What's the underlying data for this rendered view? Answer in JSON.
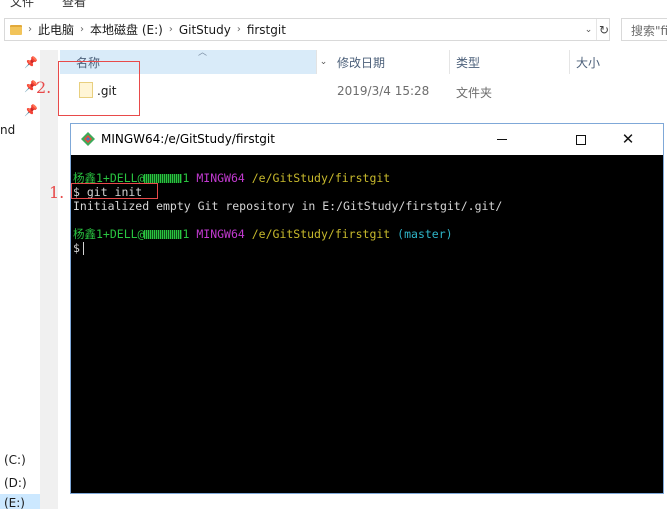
{
  "menu": {
    "items": [
      "文件",
      "查看"
    ]
  },
  "address": {
    "crumbs": [
      "此电脑",
      "本地磁盘 (E:)",
      "GitStudy",
      "firstgit"
    ],
    "dropdown_glyph": "⌄",
    "refresh_glyph": "↻"
  },
  "search": {
    "placeholder": "搜索\"firstgit\""
  },
  "nav": {
    "partial_label": "nd",
    "drives": [
      "(C:)",
      "(D:)",
      "(E:)"
    ]
  },
  "columns": {
    "name": "名称",
    "date": "修改日期",
    "type": "类型",
    "size": "大小"
  },
  "files": [
    {
      "name": ".git",
      "date": "2019/3/4 15:28",
      "type": "文件夹",
      "size": ""
    }
  ],
  "annotations": {
    "first": "1.",
    "second": "2."
  },
  "terminal": {
    "title": "MINGW64:/e/GitStudy/firstgit",
    "lines": [
      {
        "user": "杨鑫1+DELL@",
        "host_suffix": "1",
        "env": "MINGW64",
        "path": "/e/GitStudy/firstgit",
        "branch": ""
      },
      {
        "prompt": "$ git init"
      },
      {
        "output": "Initialized empty Git repository in E:/GitStudy/firstgit/.git/"
      },
      {
        "user": "杨鑫1+DELL@",
        "host_suffix": "1",
        "env": "MINGW64",
        "path": "/e/GitStudy/firstgit",
        "branch": "(master)"
      },
      {
        "prompt": "$"
      }
    ]
  },
  "colors": {
    "accent_selection": "#cce8ff",
    "annotation_red": "#e84a4a",
    "term_green": "#29c440",
    "term_magenta": "#c23ad0",
    "term_yellow": "#c7b92c",
    "term_cyan": "#2fb5c8"
  }
}
